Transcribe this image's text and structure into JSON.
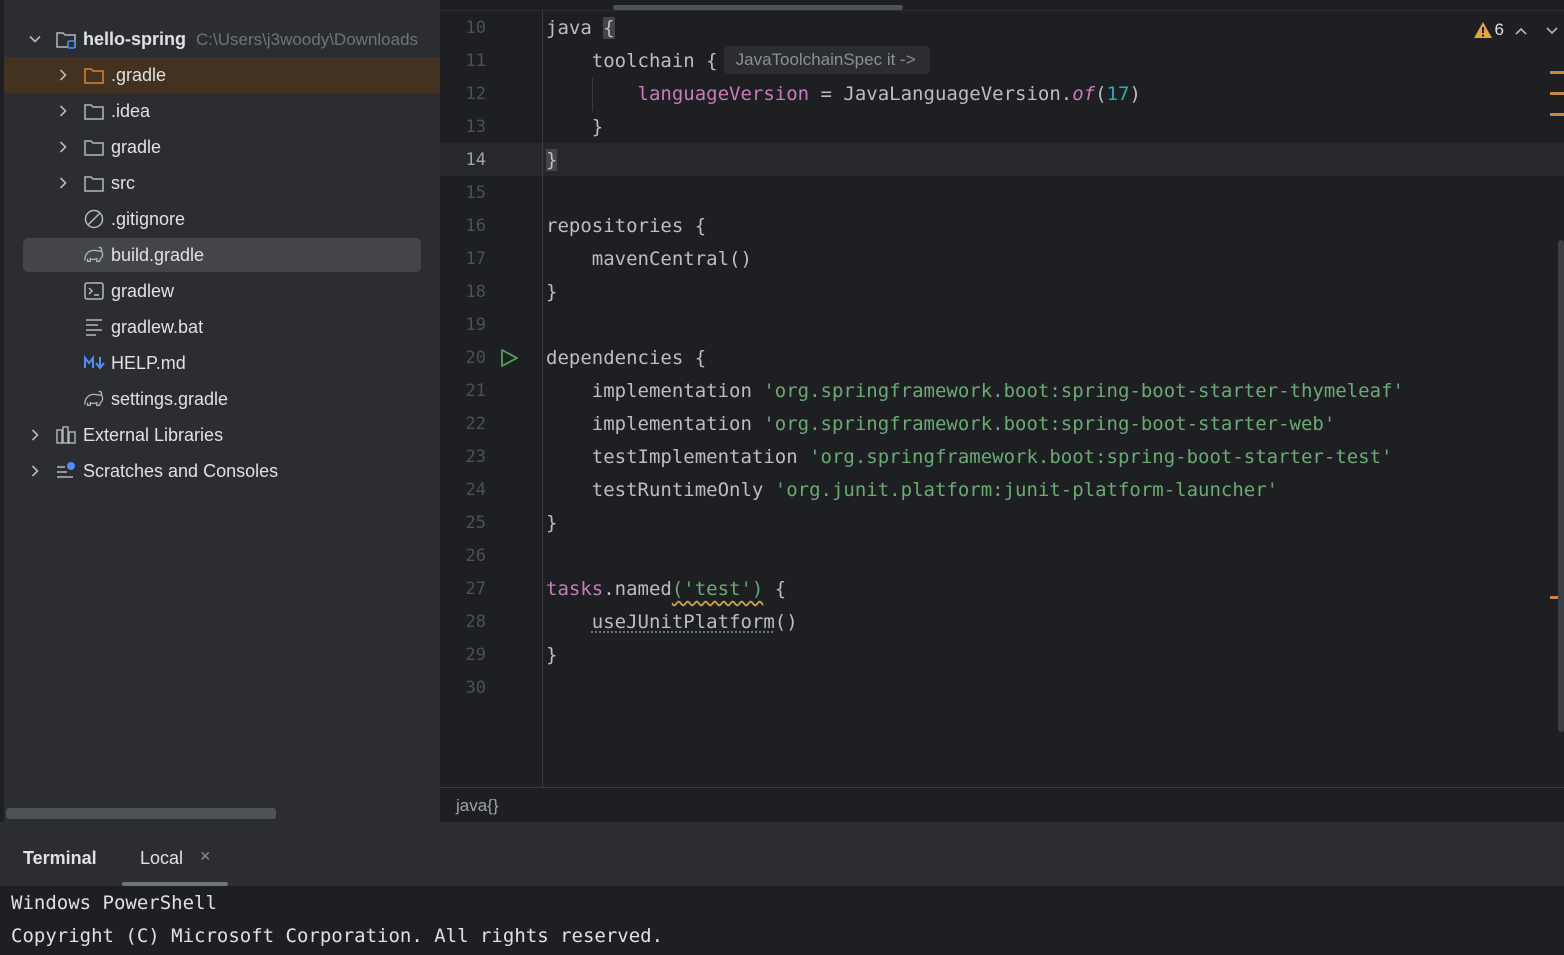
{
  "project": {
    "name": "hello-spring",
    "path": "C:\\Users\\j3woody\\Downloads",
    "items": [
      {
        "label": ".gradle"
      },
      {
        "label": ".idea"
      },
      {
        "label": "gradle"
      },
      {
        "label": "src"
      },
      {
        "label": ".gitignore"
      },
      {
        "label": "build.gradle"
      },
      {
        "label": "gradlew"
      },
      {
        "label": "gradlew.bat"
      },
      {
        "label": "HELP.md"
      },
      {
        "label": "settings.gradle"
      },
      {
        "label": "External Libraries"
      },
      {
        "label": "Scratches and Consoles"
      }
    ]
  },
  "editor": {
    "warning_count": "6",
    "breadcrumb": "java{}",
    "inlay_hint": "JavaToolchainSpec it ->",
    "line_numbers": [
      "10",
      "11",
      "12",
      "13",
      "14",
      "15",
      "16",
      "17",
      "18",
      "19",
      "20",
      "21",
      "22",
      "23",
      "24",
      "25",
      "26",
      "27",
      "28",
      "29",
      "30"
    ],
    "code": {
      "l10_kw": "java ",
      "l10_brace": "{",
      "l11_kw": "toolchain {",
      "l12_prop": "languageVersion",
      "l12_eq": " = JavaLanguageVersion.",
      "l12_of": "of",
      "l12_open": "(",
      "l12_num": "17",
      "l12_close": ")",
      "l13": "}",
      "l14": "}",
      "l16": "repositories {",
      "l17": "mavenCentral()",
      "l18": "}",
      "l20": "dependencies {",
      "l21_kw": "implementation ",
      "l21_str": "'org.springframework.boot:spring-boot-starter-thymeleaf'",
      "l22_kw": "implementation ",
      "l22_str": "'org.springframework.boot:spring-boot-starter-web'",
      "l23_kw": "testImplementation ",
      "l23_str": "'org.springframework.boot:spring-boot-starter-test'",
      "l24_kw": "testRuntimeOnly ",
      "l24_str": "'org.junit.platform:junit-platform-launcher'",
      "l25": "}",
      "l27_tasks": "tasks",
      "l27_named": ".named",
      "l27_args": "('test')",
      "l27_tail": " {",
      "l28_call": "useJUnitPlatform",
      "l28_parens": "()",
      "l29": "}"
    }
  },
  "terminal": {
    "title": "Terminal",
    "tab": "Local",
    "close": "×",
    "lines": [
      "Windows PowerShell",
      "Copyright (C) Microsoft Corporation. All rights reserved."
    ]
  },
  "colors": {
    "string": "#6aab73",
    "property": "#c77dbb",
    "number": "#2aacb8",
    "run": "#4fa34f",
    "warning": "#e2a53a"
  }
}
